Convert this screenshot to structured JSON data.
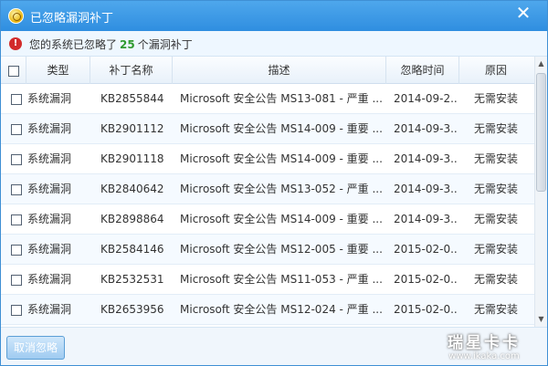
{
  "window": {
    "title": "已忽略漏洞补丁",
    "close_glyph": "✕"
  },
  "infobar": {
    "prefix": "您的系统已忽略了",
    "count": "25",
    "suffix": "个漏洞补丁"
  },
  "table": {
    "headers": {
      "type": "类型",
      "kb": "补丁名称",
      "description": "描述",
      "date": "忽略时间",
      "reason": "原因"
    },
    "rows": [
      {
        "type": "系统漏洞",
        "kb": "KB2855844",
        "description": "Microsoft 安全公告 MS13-081 - 严重 ...",
        "date": "2014-09-2...",
        "reason": "无需安装"
      },
      {
        "type": "系统漏洞",
        "kb": "KB2901112",
        "description": "Microsoft 安全公告 MS14-009 - 重要 ...",
        "date": "2014-09-3...",
        "reason": "无需安装"
      },
      {
        "type": "系统漏洞",
        "kb": "KB2901118",
        "description": "Microsoft 安全公告 MS14-009 - 重要 ...",
        "date": "2014-09-3...",
        "reason": "无需安装"
      },
      {
        "type": "系统漏洞",
        "kb": "KB2840642",
        "description": "Microsoft 安全公告 MS13-052 - 严重 ...",
        "date": "2014-09-3...",
        "reason": "无需安装"
      },
      {
        "type": "系统漏洞",
        "kb": "KB2898864",
        "description": "Microsoft 安全公告 MS14-009 - 重要 ...",
        "date": "2014-09-3...",
        "reason": "无需安装"
      },
      {
        "type": "系统漏洞",
        "kb": "KB2584146",
        "description": "Microsoft 安全公告 MS12-005 - 重要 ...",
        "date": "2015-02-0...",
        "reason": "无需安装"
      },
      {
        "type": "系统漏洞",
        "kb": "KB2532531",
        "description": "Microsoft 安全公告 MS11-053 - 严重 ...",
        "date": "2015-02-0...",
        "reason": "无需安装"
      },
      {
        "type": "系统漏洞",
        "kb": "KB2653956",
        "description": "Microsoft 安全公告 MS12-024 - 严重 ...",
        "date": "2015-02-0...",
        "reason": "无需安装"
      }
    ]
  },
  "footer": {
    "cancel_label": "取消忽略"
  },
  "watermark": {
    "title": "瑞星卡卡",
    "url": "www.ikaka.com"
  },
  "icons": {
    "app": "shield-app-icon",
    "warning": "warning-icon",
    "close": "close-icon"
  },
  "colors": {
    "titlebar": "#2f8ee0",
    "count": "#2f9a2f",
    "warning": "#d22b2b"
  }
}
